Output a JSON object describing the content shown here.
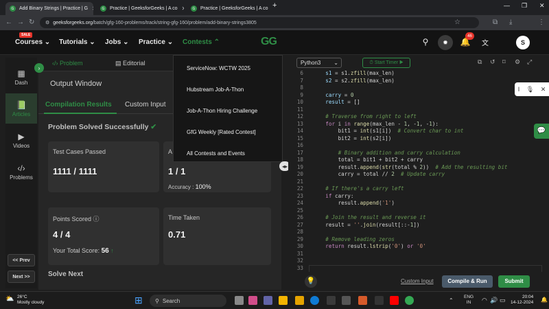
{
  "browser": {
    "tabs": [
      {
        "title": "Add Binary Strings | Practice | G",
        "active": true
      },
      {
        "title": "Practice | GeeksforGeeks | A co",
        "active": false
      },
      {
        "title": "Practice | GeeksforGeeks | A co",
        "active": false
      }
    ],
    "url_prefix": "geeksforgeeks.org",
    "url_rest": "/batch/gfg-160-problems/track/string-gfg-160/problem/add-binary-strings3805",
    "new_tab": "+"
  },
  "site_nav": {
    "sale_badge": "SALE",
    "items": [
      "Courses",
      "Tutorials",
      "Jobs",
      "Practice",
      "Contests"
    ],
    "logo": "GG",
    "notification_count": "46",
    "avatar_letter": "S"
  },
  "sidebar": {
    "items": [
      "Dash",
      "Articles",
      "Videos",
      "Problems"
    ],
    "prev": "<< Prev",
    "next": "Next >>"
  },
  "problem_panel": {
    "tabs": [
      "Problem",
      "Editorial"
    ],
    "output_title": "Output Window",
    "subtabs": [
      "Compilation Results",
      "Custom Input"
    ],
    "status": "Problem Solved Successfully",
    "cards": {
      "tests_label": "Test Cases Passed",
      "tests_value": "1111 / 1111",
      "attempts_label": "A",
      "attempts_value": "1 / 1",
      "accuracy_label": "Accuracy :",
      "accuracy_value": "100%",
      "points_label": "Points Scored",
      "points_value": "4 / 4",
      "total_label": "Your Total Score:",
      "total_value": "56",
      "time_label": "Time Taken",
      "time_value": "0.71"
    },
    "solve_next": "Solve Next"
  },
  "contests_menu": [
    "ServiceNow: WCTW 2025",
    "Hubstream Job-A-Thon",
    "Job-A-Thon Hiring Challenge",
    "GfG Weekly [Rated Contest]",
    "All Contests and Events"
  ],
  "editor": {
    "language": "Python3",
    "start_timer": "Start Timer",
    "line_numbers": [
      "6",
      "7",
      "8",
      "9",
      "10",
      "11",
      "12",
      "13",
      "14",
      "15",
      "16",
      "17",
      "18",
      "19",
      "20",
      "21",
      "22",
      "23",
      "24",
      "25",
      "26",
      "27",
      "28",
      "29",
      "30",
      "31",
      "32",
      "33"
    ],
    "custom_input": "Custom Input",
    "compile_run": "Compile & Run",
    "submit": "Submit"
  },
  "taskbar": {
    "weather_temp": "26°C",
    "weather_desc": "Mostly cloudy",
    "search": "Search",
    "lang1": "ENG",
    "lang2": "IN",
    "time": "20:04",
    "date": "14-12-2024"
  }
}
